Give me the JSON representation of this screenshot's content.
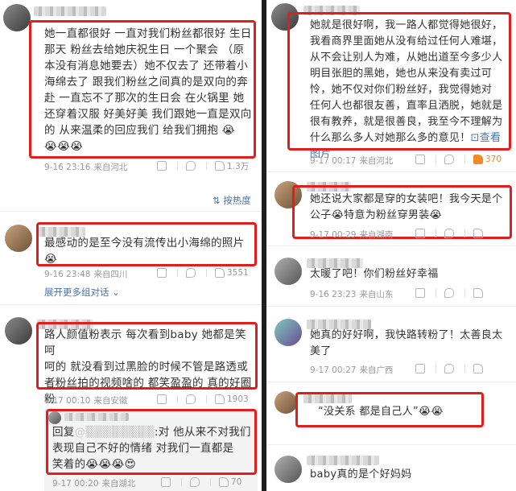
{
  "left": {
    "c1": {
      "lines": [
        "她一直都很好 一直对我们粉丝都很好 生日",
        "那天 粉丝去给她庆祝生日 一个聚会 （原",
        "本没有消息她要去）她不仅去了 还带着小",
        "海绵去了 跟我们粉丝之间真的是双向的奔",
        "赴 一直忘不了那次的生日会 在火锅里 她",
        "还穿着汉服 好美好美 我们跟她一直是双向",
        "的 从来温柔的回应我们 给我们拥抱 😭",
        "😭😭😭"
      ],
      "time": "9-16 23:16",
      "source": "来自河北",
      "likes": "1.3万"
    },
    "hot_sort": "按热度",
    "c2": {
      "lines": [
        "最感动的是至今没有流传出小海绵的照片",
        "😭"
      ],
      "time": "9-16 23:48",
      "source": "来自四川",
      "likes": "3551"
    },
    "expand_text": "展开更多组对话 ⌄",
    "c3": {
      "lines": [
        "路人颜值粉表示 每次看到baby 她都是笑呵",
        "呵的 就没看到过黑脸的时候不管是路透或",
        "者粉丝拍的视频啥的 都笑盈盈的 真的好圈",
        "粉"
      ],
      "time": "9-17 00:10",
      "source": "来自安徽",
      "likes": "1903"
    },
    "c4": {
      "reply_prefix": "回复",
      "reply_handle": "@▒▒▒▒▒▒▒▒",
      "lines_after": ":对 他从来不对我们",
      "lines": [
        "表现自己不好的情绪 对我们一直都是",
        "笑着的😭😭😭😍"
      ],
      "time": "9-17 00:20",
      "source": "来自湖北",
      "likes": "70"
    }
  },
  "right": {
    "c1": {
      "lines": [
        "她就是很好啊，我一路人都觉得她很好，",
        "我看商界里面她从没有给过任何人难堪，",
        "从不会让别人为难，从她出道至今多少人",
        "明目张胆的黑她，她也从来没有卖过可",
        "怜，她不仅对你们粉丝好，我觉得她对",
        "任何人也都很友善，直率且洒脱，她就是",
        "很有教养，就是很善良，我至今不理解为",
        "什么那么多人对她那么多的意见！"
      ],
      "pic_label": "⊡查看",
      "pic_label2": "图片",
      "time": "9-17 00:17",
      "source": "来自河北",
      "likes": "370"
    },
    "c2": {
      "lines": [
        "她还说大家都是穿的女装吧！我今天是个",
        "公子😭特意为粉丝穿男装😭"
      ],
      "time": "9-17 00:29",
      "source": "来自湖南",
      "likes": ""
    },
    "c3": {
      "lines": [
        "太暖了吧！你们粉丝好幸福"
      ],
      "time": "9-16 23:23",
      "source": "来自山东"
    },
    "c4": {
      "lines": [
        "她真的好好啊，我快路转粉了！太善良太",
        "美了"
      ],
      "time": "9-17 00:27",
      "source": "来自广西"
    },
    "c5": {
      "lines": [
        "“没关系 都是自己人”😭😭"
      ]
    },
    "c6": {
      "lines": [
        "baby真的是个好妈妈"
      ]
    }
  }
}
